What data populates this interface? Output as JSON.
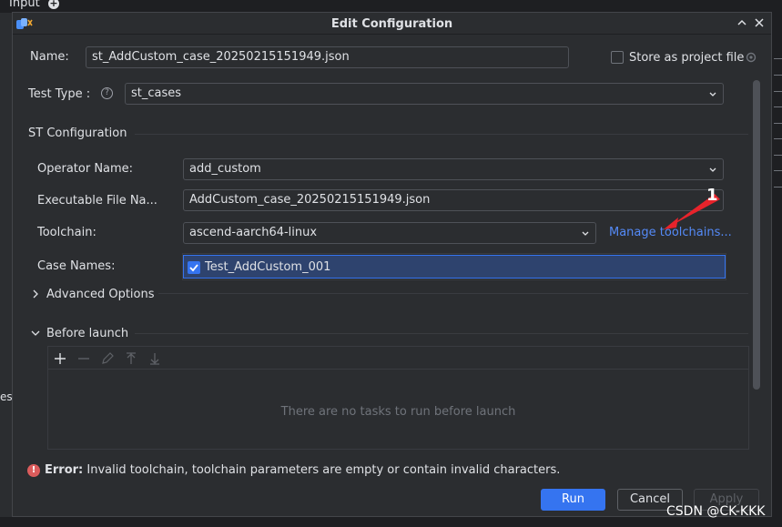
{
  "background": {
    "top_label": "Input",
    "left_label": "es"
  },
  "dialog": {
    "title": "Edit Configuration",
    "close_icon": "close-icon",
    "accent_color": "#3574f0",
    "link_color": "#548af7",
    "error_color": "#db5c5c"
  },
  "name": {
    "label": "Name:",
    "value": "st_AddCustom_case_20250215151949.json",
    "store_label": "Store as project file",
    "store_checked": false
  },
  "test_type": {
    "label": "Test Type :",
    "value": "st_cases"
  },
  "st_config": {
    "section_title": "ST Configuration",
    "operator_label": "Operator Name:",
    "operator_value": "add_custom",
    "executable_label": "Executable File Na...",
    "executable_value": "AddCustom_case_20250215151949.json",
    "toolchain_label": "Toolchain:",
    "toolchain_value": "ascend-aarch64-linux",
    "manage_link": "Manage toolchains...",
    "case_names_label": "Case Names:",
    "cases": [
      {
        "label": "Test_AddCustom_001",
        "checked": true
      }
    ]
  },
  "advanced": {
    "label": "Advanced Options"
  },
  "before_launch": {
    "label": "Before launch",
    "empty_text": "There are no tasks to run before launch"
  },
  "error": {
    "prefix": "Error:",
    "message": "Invalid toolchain, toolchain parameters are empty or contain invalid characters."
  },
  "buttons": {
    "run": "Run",
    "cancel": "Cancel",
    "apply": "Apply"
  },
  "annotation": {
    "number": "1"
  },
  "watermark": "CSDN @CK-KKK"
}
